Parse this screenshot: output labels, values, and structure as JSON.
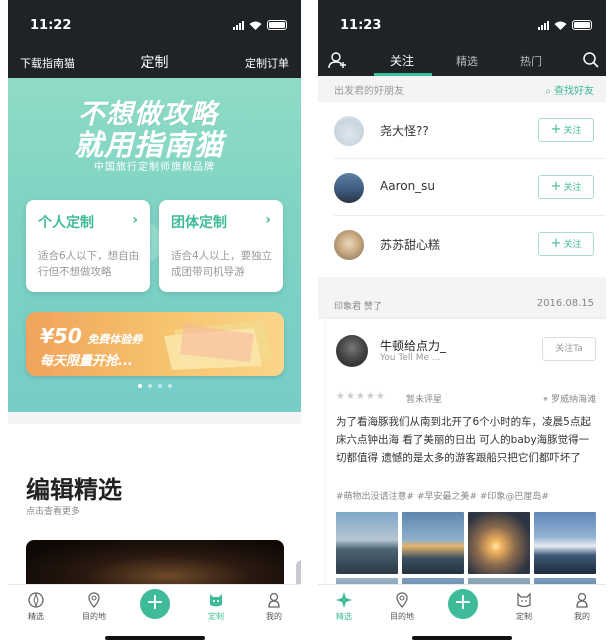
{
  "left": {
    "status_time": "11:22",
    "nav": {
      "left": "下载指南猫",
      "title": "定制",
      "right": "定制订单"
    },
    "banner": {
      "headline_1": "不想做攻略",
      "headline_2": "就用指南猫",
      "subtitle": "中国旅行定制师旗舰品牌",
      "cards": [
        {
          "title": "个人定制",
          "desc": "适合6人以下，想自由行但不想做攻略"
        },
        {
          "title": "团体定制",
          "desc": "适合4人以上，要独立成团带司机导游"
        }
      ],
      "promo_amount": "¥50",
      "promo_tag": "免费体验券",
      "promo_line2": "每天限量开抢...",
      "dot_count": 4,
      "active_dot": 0
    },
    "section": {
      "title": "编辑精选",
      "subtitle": "点击查看更多"
    },
    "tabs": [
      {
        "label": "精选",
        "icon": "compass-icon"
      },
      {
        "label": "目的地",
        "icon": "location-pin-icon"
      },
      {
        "label": "",
        "icon": "plus-icon"
      },
      {
        "label": "定制",
        "icon": "cat-icon"
      },
      {
        "label": "我的",
        "icon": "person-icon"
      }
    ],
    "active_tab": 3
  },
  "right": {
    "status_time": "11:23",
    "nav_tabs": [
      "关注",
      "精选",
      "热门"
    ],
    "active_nav_tab": 0,
    "friends_header": {
      "title": "出发君的好朋友",
      "find": "查找好友"
    },
    "friends": [
      {
        "name": "尧大怪??",
        "follow": "关注"
      },
      {
        "name": "Aaron_su",
        "follow": "关注"
      },
      {
        "name": "苏苏甜心糕",
        "follow": "关注"
      }
    ],
    "feed_meta": {
      "who": "印象君  赞了",
      "date": "2016.08.15"
    },
    "post": {
      "author": "牛顿给点力_",
      "song": "You Tell Me ...",
      "follow": "关注Ta",
      "stars": "★★★★★",
      "rating": "暂未评星",
      "location": "罗威纳海滩",
      "text": "为了看海豚我们从南到北开了6个小时的车，凌晨5点起床六点钟出海 看了美丽的日出 可人的baby海豚觉得一切都值得 遗憾的是太多的游客跟船只把它们都吓坏了",
      "tags": "#萌物出没请注意#  #早安最之美#  #印象@巴厘岛#"
    },
    "tabs": [
      {
        "label": "精选",
        "icon": "compass-icon"
      },
      {
        "label": "目的地",
        "icon": "location-pin-icon"
      },
      {
        "label": "",
        "icon": "plus-icon"
      },
      {
        "label": "定制",
        "icon": "cat-icon"
      },
      {
        "label": "我的",
        "icon": "person-icon"
      }
    ],
    "active_tab": 0
  },
  "colors": {
    "brand_green": "#3fbb9a",
    "navbar": "#1f2326",
    "promo_orange": "#f0a35b"
  }
}
